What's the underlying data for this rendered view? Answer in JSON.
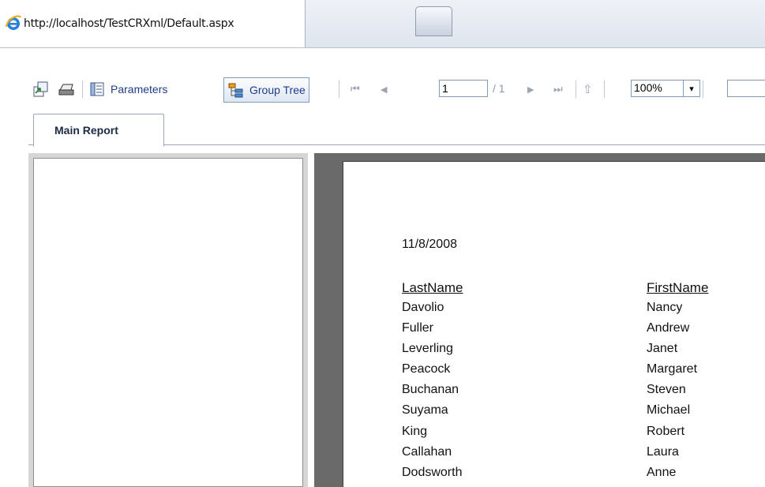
{
  "browser": {
    "tab_title": "http://localhost/TestCRXml/Default.aspx"
  },
  "toolbar": {
    "parameters_label": "Parameters",
    "group_tree_label": "Group Tree",
    "page_number": "1",
    "page_of": "/ 1",
    "zoom": "100%",
    "search_value": ""
  },
  "report_tabs": [
    {
      "label": "Main Report"
    }
  ],
  "report": {
    "date": "11/8/2008",
    "columns": [
      "LastName",
      "FirstName"
    ],
    "rows": [
      [
        "Davolio",
        "Nancy"
      ],
      [
        "Fuller",
        "Andrew"
      ],
      [
        "Leverling",
        "Janet"
      ],
      [
        "Peacock",
        "Margaret"
      ],
      [
        "Buchanan",
        "Steven"
      ],
      [
        "Suyama",
        "Michael"
      ],
      [
        "King",
        "Robert"
      ],
      [
        "Callahan",
        "Laura"
      ],
      [
        "Dodsworth",
        "Anne"
      ]
    ]
  }
}
